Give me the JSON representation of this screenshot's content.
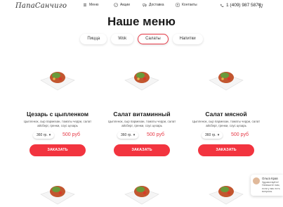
{
  "brand": {
    "logo": "ПапаСанчиго"
  },
  "nav": {
    "items": [
      {
        "label": "Меню",
        "icon": "menu-icon"
      },
      {
        "label": "Акции",
        "icon": "percent-icon"
      },
      {
        "label": "Доставка",
        "icon": "truck-icon"
      },
      {
        "label": "Контакты",
        "icon": "contacts-icon"
      }
    ],
    "phone": "1 (409) 987 5874"
  },
  "page": {
    "title": "Наше меню"
  },
  "tabs": [
    {
      "label": "Пицца",
      "active": false
    },
    {
      "label": "Wok",
      "active": false
    },
    {
      "label": "Салаты",
      "active": true
    },
    {
      "label": "Напитки",
      "active": false
    }
  ],
  "products": [
    {
      "name": "Цезарь с цыпленком",
      "description": "Цыпленок, сыр пармезан, томаты черри, салат айсберг, гренки, соус цезарь",
      "weight": "360 гр.",
      "price": "500 руб",
      "button": "ЗАКАЗАТЬ"
    },
    {
      "name": "Салат витаминный",
      "description": "Цыпленок, сыр пармезан, томаты черри, салат айсберг, гренки, соус цезарь",
      "weight": "360 гр.",
      "price": "500 руб",
      "button": "ЗАКАЗАТЬ"
    },
    {
      "name": "Салат мясной",
      "description": "Цыпленок, сыр пармезан, томаты черри, салат айсберг, гренки, соус цезарь",
      "weight": "360 гр.",
      "price": "500 руб",
      "button": "ЗАКАЗАТЬ"
    }
  ],
  "chat": {
    "name": "Ольга Крав",
    "text": "Здравствуйте! Напишите нам, если у вас есть вопросы."
  },
  "colors": {
    "accent": "#f2343f",
    "price": "#e63946"
  }
}
